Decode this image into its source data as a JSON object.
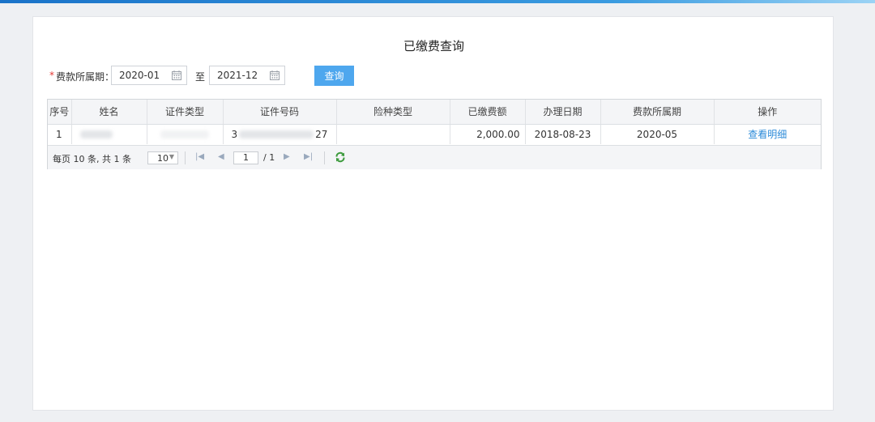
{
  "page": {
    "title": "已缴费查询"
  },
  "filter": {
    "required_mark": "*",
    "label": "费款所属期：",
    "start_value": "2020-01",
    "separator": "至",
    "end_value": "2021-12",
    "query_label": "查询",
    "calendar_icon": "calendar-icon"
  },
  "table": {
    "headers": [
      "序号",
      "姓名",
      "证件类型",
      "证件号码",
      "险种类型",
      "已缴费额",
      "办理日期",
      "费款所属期",
      "操作"
    ],
    "rows": [
      {
        "index": "1",
        "id_number_prefix": "3",
        "id_number_suffix": "27",
        "amount": "2,000.00",
        "handle_date": "2018-08-23",
        "fee_period": "2020-05",
        "action": "查看明细"
      }
    ]
  },
  "pager": {
    "summary": "每页 10 条, 共 1 条",
    "page_size": "10",
    "current_page": "1",
    "total_pages": "/ 1",
    "icons": [
      "first-page-icon",
      "prev-page-icon",
      "next-page-icon",
      "last-page-icon",
      "refresh-icon"
    ]
  },
  "colors": {
    "accent": "#4ea7ee",
    "link": "#2b8ad8",
    "required": "#e53935"
  }
}
